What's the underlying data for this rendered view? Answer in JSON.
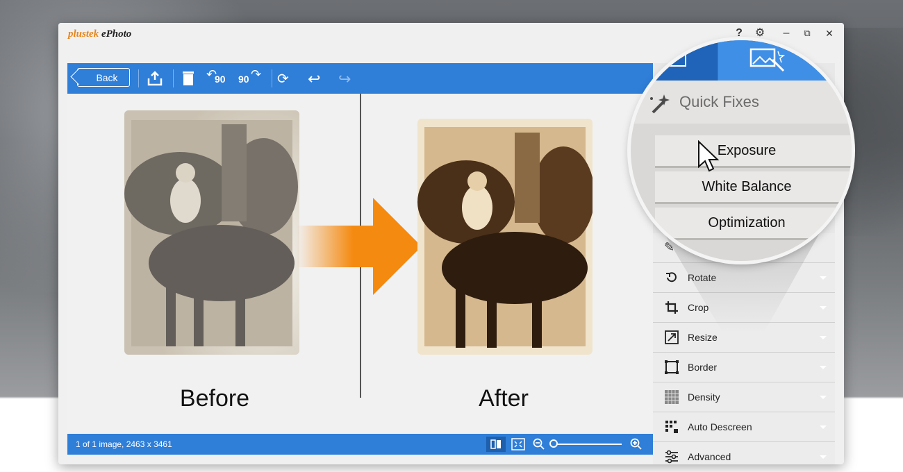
{
  "app": {
    "brand": "plustek",
    "name": "ePhoto"
  },
  "window_controls": {
    "help": "?",
    "settings": "⚙",
    "minimize": "–",
    "restore": "⧉",
    "close": "✕"
  },
  "toolbar": {
    "back_label": "Back",
    "rotate_left_label": "90",
    "rotate_right_label": "90"
  },
  "content": {
    "before_label": "Before",
    "after_label": "After"
  },
  "statusbar": {
    "info": "1 of 1 image, 2463 x 3461"
  },
  "zoom": {
    "level": 0.0
  },
  "panel": {
    "items": [
      {
        "label": "Rotate",
        "icon": "rotate-icon"
      },
      {
        "label": "Crop",
        "icon": "crop-icon"
      },
      {
        "label": "Resize",
        "icon": "resize-icon"
      },
      {
        "label": "Border",
        "icon": "border-icon"
      },
      {
        "label": "Density",
        "icon": "density-icon"
      },
      {
        "label": "Auto Descreen",
        "icon": "descreen-icon"
      },
      {
        "label": "Advanced",
        "icon": "sliders-icon"
      }
    ]
  },
  "magnifier": {
    "section_title": "Quick Fixes",
    "buttons": [
      "Exposure",
      "White Balance",
      "Optimization"
    ]
  },
  "colors": {
    "accent": "#2f7ed8",
    "arrow": "#f58a11",
    "sepia": "#8a7458"
  }
}
